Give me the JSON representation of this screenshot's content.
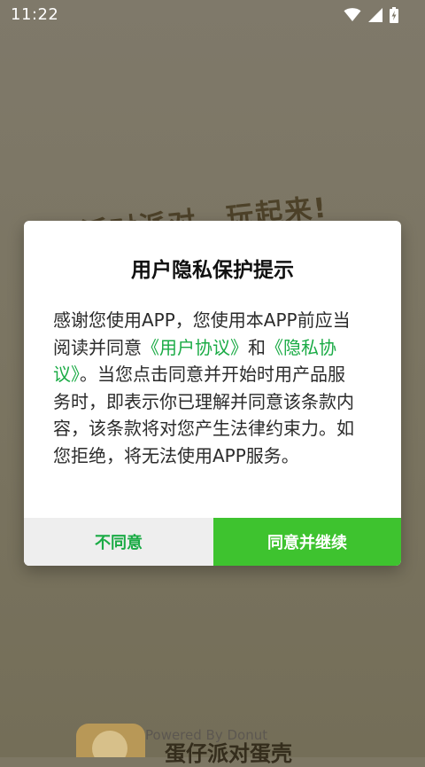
{
  "status_bar": {
    "time": "11:22",
    "icons": [
      "wifi-icon",
      "cell-signal-icon",
      "battery-charging-icon"
    ]
  },
  "background": {
    "banner_text": "派对派对，玩起来!",
    "powered_by": "Powered By Donut",
    "app_title": "蛋仔派对蛋壳"
  },
  "dialog": {
    "title": "用户隐私保护提示",
    "body_segments": {
      "p1": "感谢您使用APP，您使用本APP前应当阅读并同意",
      "link_user_agreement": "《用户协议》",
      "p2": "和",
      "link_privacy_agreement": "《隐私协议》",
      "p3": "。当您点击同意并开始时用产品服务时，即表示你已理解并同意该条款内容，该条款将对您产生法律约束力。如您拒绝，将无法使用APP服务。"
    },
    "buttons": {
      "disagree": "不同意",
      "agree": "同意并继续"
    }
  },
  "colors": {
    "accent_green": "#1aab45",
    "agree_button_bg": "#3ec32f",
    "disagree_button_bg": "#eeeeee",
    "overlay_bg": "#7d7764"
  }
}
